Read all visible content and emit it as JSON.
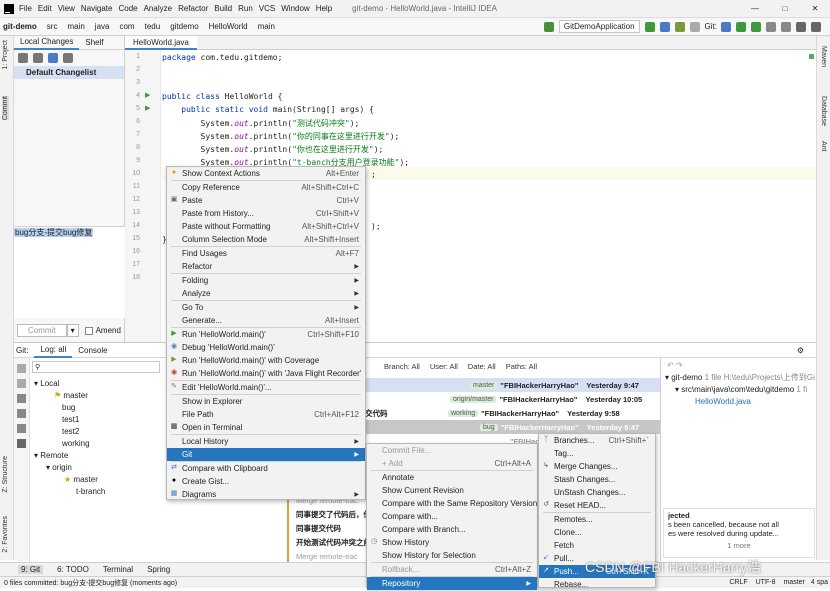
{
  "menu": [
    "File",
    "Edit",
    "View",
    "Navigate",
    "Code",
    "Analyze",
    "Refactor",
    "Build",
    "Run",
    "VCS",
    "Window",
    "Help"
  ],
  "window_title": "git-demo - HelloWorld.java - IntelliJ IDEA",
  "breadcrumbs": [
    "git-demo",
    "src",
    "main",
    "java",
    "com",
    "tedu",
    "gitdemo",
    "HelloWorld",
    "main"
  ],
  "run_config": "GitDemoApplication",
  "git_label": "Git:",
  "left_strip": {
    "project": "1: Project",
    "commit": "Commit",
    "structure": "Z: Structure",
    "favorites": "2: Favorites"
  },
  "right_strip": [
    "Maven",
    "Database",
    "Ant"
  ],
  "commit_panel": {
    "tab_local": "Local Changes",
    "tab_shelf": "Shelf",
    "changelist": "Default Changelist",
    "message": "bug分支-提交bug修复",
    "commit_btn": "Commit",
    "amend": "Amend"
  },
  "editor": {
    "tab": "HelloWorld.java",
    "lines": [
      "1",
      "2",
      "3",
      "4",
      "5",
      "6",
      "7",
      "8",
      "9",
      "10",
      "11",
      "12",
      "13",
      "14",
      "15",
      "16",
      "17",
      "18"
    ],
    "code": {
      "l1a": "package ",
      "l1b": "com.tedu.gitdemo;",
      "l4a": "public class ",
      "l4b": "HelloWorld {",
      "l5a": "    public static void ",
      "l5b": "main(String[] args) {",
      "p1": "测试代码冲突",
      "p2": "你的同事在这里进行开发",
      "p3": "你也在这里进行开发",
      "p4": "t-banch分支用户登录功能",
      "sys": "        System.",
      "out": "out",
      ".pl": ".println(",
      "close1": ");",
      "tail1": ";",
      "tail2": ");",
      "brace1": "}",
      "brace2": "}"
    }
  },
  "git_panel": {
    "tab_git": "Git:",
    "tab_log": "Log: all",
    "tab_console": "Console",
    "filters": {
      "branch": "Branch: All",
      "user": "User: All",
      "date": "Date: All",
      "paths": "Paths: All"
    },
    "tree": {
      "local": "Local",
      "master": "master",
      "bug": "bug",
      "test1": "test1",
      "test2": "test2",
      "working": "working",
      "remote": "Remote",
      "origin": "origin",
      "rmaster": "master",
      "tbranch": "t-branch"
    },
    "log": [
      {
        "msg": "p",
        "tag": "master",
        "author": "\"FBIHackerHarryHao\"",
        "date": "Yesterday 9:47"
      },
      {
        "msg": "分支",
        "tag": "origin/master",
        "author": "\"FBIHackerHarryHao\"",
        "date": "Yesterday 10:05"
      },
      {
        "msg": "试提交代码",
        "tag": "working",
        "author": "\"FBIHackerHarryHao\"",
        "date": "Yesterday 9:58"
      },
      {
        "msg": "",
        "tag": "bug",
        "author": "\"FBIHackerHarryHao\"",
        "date": "Yesterday 9:47"
      },
      {
        "msg": "",
        "tag": "",
        "author": "\"FBIHacker",
        "date": ""
      }
    ],
    "log_lower": [
      "Merge remote-trac",
      "同事提交了代码后，你",
      "同事提交代码",
      "开始测试代码冲突之前",
      "Merge remote-trac"
    ],
    "details": {
      "root": "git-demo",
      "root_meta": "1 file  H:\\tedu\\Projects\\上传到Gi",
      "path": "src\\main\\java\\com\\tedu\\gitdemo",
      "path_meta": "1 fi",
      "file": "HelloWorld.java"
    },
    "notif": {
      "title": "jected",
      "line1": "s been cancelled, because not all",
      "line2": "es were resolved during update...",
      "more": "1 more"
    }
  },
  "context_menu": [
    {
      "label": "Show Context Actions",
      "sc": "Alt+Enter",
      "icon": "bulb-icon"
    },
    {
      "sep": true
    },
    {
      "label": "Copy Reference",
      "sc": "Alt+Shift+Ctrl+C"
    },
    {
      "label": "Paste",
      "sc": "Ctrl+V",
      "icon": "paste-icon"
    },
    {
      "label": "Paste from History...",
      "sc": "Ctrl+Shift+V"
    },
    {
      "label": "Paste without Formatting",
      "sc": "Alt+Shift+Ctrl+V"
    },
    {
      "label": "Column Selection Mode",
      "sc": "Alt+Shift+Insert"
    },
    {
      "sep": true
    },
    {
      "label": "Find Usages",
      "sc": "Alt+F7"
    },
    {
      "label": "Refactor",
      "arrow": true
    },
    {
      "sep": true
    },
    {
      "label": "Folding",
      "arrow": true
    },
    {
      "label": "Analyze",
      "arrow": true
    },
    {
      "sep": true
    },
    {
      "label": "Go To",
      "arrow": true
    },
    {
      "label": "Generate...",
      "sc": "Alt+Insert"
    },
    {
      "sep": true
    },
    {
      "label": "Run 'HelloWorld.main()'",
      "sc": "Ctrl+Shift+F10",
      "icon": "run-icon"
    },
    {
      "label": "Debug 'HelloWorld.main()'",
      "icon": "debug-icon"
    },
    {
      "label": "Run 'HelloWorld.main()' with Coverage",
      "icon": "coverage-icon"
    },
    {
      "label": "Run 'HelloWorld.main()' with 'Java Flight Recorder'",
      "icon": "jfr-icon"
    },
    {
      "sep": true
    },
    {
      "label": "Edit 'HelloWorld.main()'...",
      "icon": "edit-config-icon"
    },
    {
      "sep": true
    },
    {
      "label": "Show in Explorer"
    },
    {
      "label": "File Path",
      "sc": "Ctrl+Alt+F12"
    },
    {
      "label": "Open in Terminal",
      "icon": "terminal-icon"
    },
    {
      "sep": true
    },
    {
      "label": "Local History",
      "arrow": true
    },
    {
      "label": "Git",
      "arrow": true,
      "sel": true
    },
    {
      "sep": true
    },
    {
      "label": "Compare with Clipboard",
      "icon": "compare-icon"
    },
    {
      "label": "Create Gist...",
      "icon": "github-icon"
    },
    {
      "label": "Diagrams",
      "arrow": true,
      "icon": "diagram-icon"
    }
  ],
  "git_menu": [
    {
      "label": "Commit File...",
      "dis": true
    },
    {
      "label": "+ Add",
      "sc": "Ctrl+Alt+A",
      "dis": true
    },
    {
      "sep": true
    },
    {
      "label": "Annotate"
    },
    {
      "label": "Show Current Revision"
    },
    {
      "label": "Compare with the Same Repository Version"
    },
    {
      "label": "Compare with..."
    },
    {
      "label": "Compare with Branch..."
    },
    {
      "label": "Show History",
      "icon": "history-icon"
    },
    {
      "label": "Show History for Selection"
    },
    {
      "sep": true
    },
    {
      "label": "Rollback...",
      "sc": "Ctrl+Alt+Z",
      "dis": true
    },
    {
      "sep": true
    },
    {
      "label": "Repository",
      "arrow": true,
      "sel": true
    }
  ],
  "repo_menu": [
    {
      "label": "Branches...",
      "sc": "Ctrl+Shift+`",
      "icon": "branch-icon"
    },
    {
      "label": "Tag..."
    },
    {
      "label": "Merge Changes...",
      "icon": "merge-icon"
    },
    {
      "label": "Stash Changes..."
    },
    {
      "label": "UnStash Changes..."
    },
    {
      "label": "Reset HEAD...",
      "icon": "reset-icon"
    },
    {
      "sep": true
    },
    {
      "label": "Remotes..."
    },
    {
      "label": "Clone..."
    },
    {
      "label": "Fetch"
    },
    {
      "label": "Pull...",
      "icon": "pull-icon"
    },
    {
      "label": "Push...",
      "sc": "Ctrl+Shift+K",
      "sel": true,
      "icon": "push-icon"
    },
    {
      "label": "Rebase..."
    }
  ],
  "bottom_tools": [
    "9: Git",
    "6: TODO",
    "Terminal",
    "Spring"
  ],
  "status": {
    "left": "0 files committed: bug分支-提交bug修复 (moments ago)",
    "crlf": "CRLF",
    "enc": "UTF-8",
    "branch": "master",
    "spaces": "4 spa"
  },
  "watermark": "CSDN @FBI HackerHarry浩"
}
